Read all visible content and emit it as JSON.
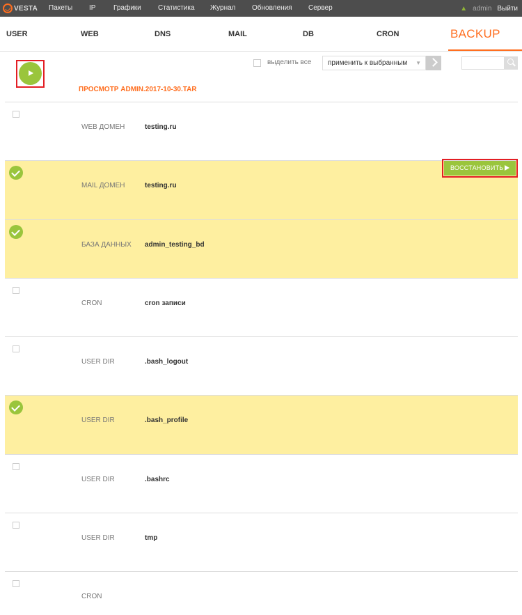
{
  "topbar": {
    "logo": "VESTA",
    "nav": [
      "Пакеты",
      "IP",
      "Графики",
      "Статистика",
      "Журнал",
      "Обновления",
      "Сервер"
    ],
    "username": "admin",
    "logout": "Выйти"
  },
  "tabs": [
    "USER",
    "WEB",
    "DNS",
    "MAIL",
    "DB",
    "CRON",
    "BACKUP"
  ],
  "active_tab": "BACKUP",
  "toolbar": {
    "select_all": "выделить все",
    "action_select": "применить к выбранным",
    "search_placeholder": ""
  },
  "page_heading": "ПРОСМОТР ADMIN.2017-10-30.TAR",
  "restore_label": "ВОССТАНОВИТЬ",
  "rows": [
    {
      "type": "WEB ДОМЕН",
      "name": "testing.ru",
      "selected": false
    },
    {
      "type": "MAIL ДОМЕН",
      "name": "testing.ru",
      "selected": true
    },
    {
      "type": "БАЗА ДАННЫХ",
      "name": "admin_testing_bd",
      "selected": true
    },
    {
      "type": "CRON",
      "name": "cron записи",
      "selected": false
    },
    {
      "type": "USER DIR",
      "name": ".bash_logout",
      "selected": false
    },
    {
      "type": "USER DIR",
      "name": ".bash_profile",
      "selected": true
    },
    {
      "type": "USER DIR",
      "name": ".bashrc",
      "selected": false
    },
    {
      "type": "USER DIR",
      "name": "tmp",
      "selected": false
    },
    {
      "type": "CRON",
      "name": "",
      "selected": false
    }
  ],
  "colors": {
    "accent": "#ff6e1f",
    "green": "#9ac53c",
    "selected_row": "#feefa0",
    "topbar": "#4d4d4d",
    "highlight_frame": "#e31e24"
  }
}
